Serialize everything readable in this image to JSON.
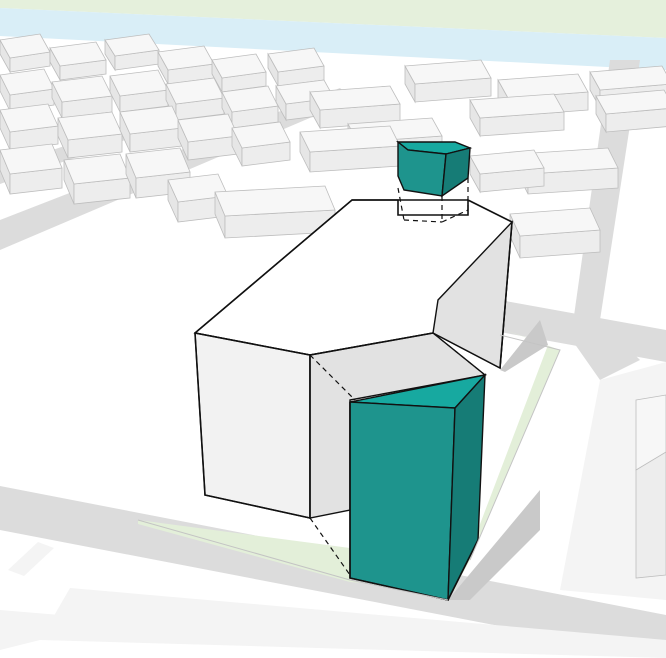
{
  "view": {
    "type": "axonometric massing study",
    "text": []
  },
  "colors": {
    "background": "#ffffff",
    "road": "#dcdcdc",
    "sidewalk": "#f4f4f4",
    "water": "#d9eef7",
    "park": "#e5f0dc",
    "grass_strip": "#e3efd9",
    "context_top": "#f7f7f7",
    "context_side": "#e6e6e6",
    "context_front": "#ededed",
    "massing_top": "#ffffff",
    "massing_side_light": "#f2f2f2",
    "massing_side_shade": "#e2e2e2",
    "accent_top": "#17a9a0",
    "accent_front": "#1e948d",
    "accent_side": "#167c76",
    "outline": "#111111",
    "shadow": "#c9c9c9"
  },
  "legend": []
}
